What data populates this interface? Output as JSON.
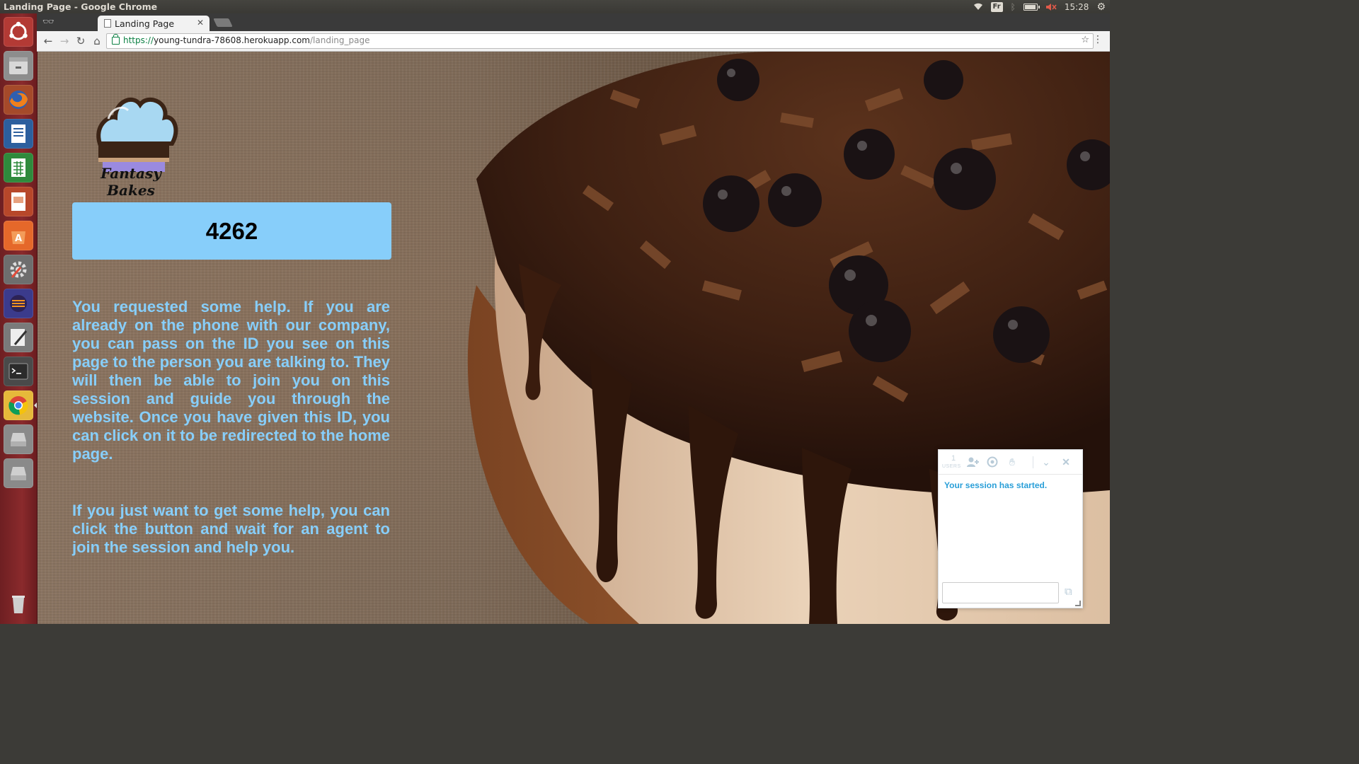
{
  "window": {
    "title": "Landing Page - Google Chrome",
    "clock": "15:28",
    "keyboard_layout": "Fr"
  },
  "browser": {
    "tab_title": "Landing Page",
    "url_scheme": "https://",
    "url_host": "young-tundra-78608.herokuapp.com",
    "url_path": "/landing_page"
  },
  "launcher": {
    "apps": [
      "ubuntu-dash",
      "files",
      "firefox",
      "libreoffice-writer",
      "libreoffice-calc",
      "libreoffice-impress",
      "software-center",
      "system-settings",
      "eclipse",
      "text-editor",
      "terminal",
      "chrome",
      "disk-drive",
      "disk-drive-2",
      "trash"
    ]
  },
  "page": {
    "logo_text": "Fantasy Bakes",
    "session_id": "4262",
    "paragraph1": "You requested some help. If you are already on the phone with our company, you can pass on the ID you see on this page to the person you are talking to. They will then be able to join you on this session and guide you through the website. Once you have given this ID, you can click on it to be redirected to the home page.",
    "paragraph2": "If you just want to get some help, you can click the button and wait for an agent to join the session and help you."
  },
  "widget": {
    "users_count": "1",
    "users_label": "USERS",
    "status_message": "Your session has started.",
    "accent_color": "#2a9fd8"
  },
  "colors": {
    "text_accent": "#87cefa",
    "id_box": "#87cefa",
    "launcher": "#8a2a2c"
  }
}
